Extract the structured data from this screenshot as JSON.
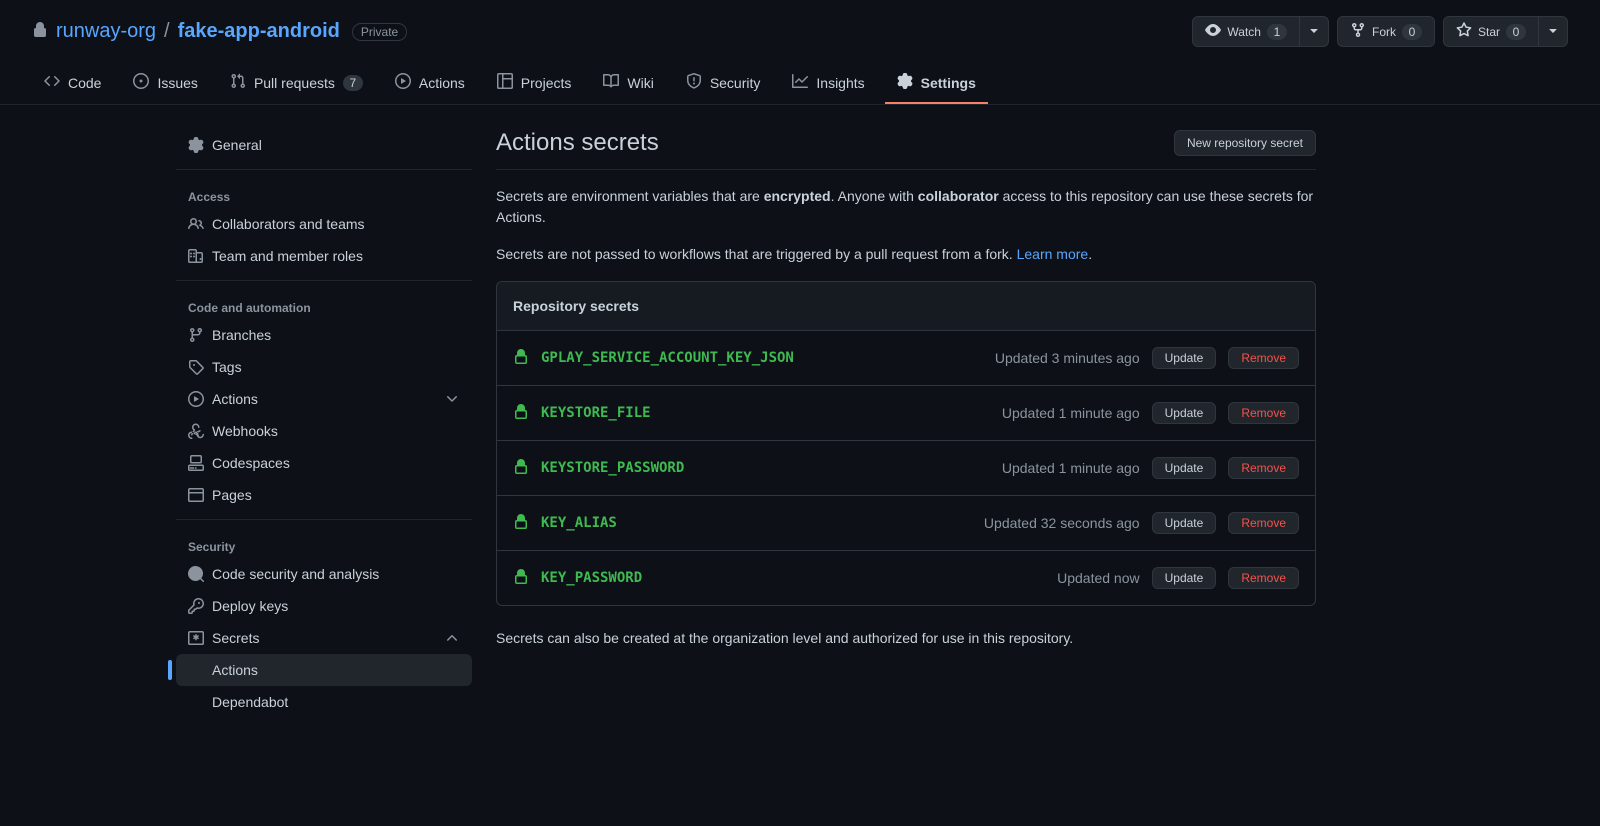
{
  "header": {
    "org": "runway-org",
    "repo": "fake-app-android",
    "visibility": "Private",
    "watch": {
      "label": "Watch",
      "count": "1"
    },
    "fork": {
      "label": "Fork",
      "count": "0"
    },
    "star": {
      "label": "Star",
      "count": "0"
    }
  },
  "tabs": {
    "code": "Code",
    "issues": "Issues",
    "pulls": "Pull requests",
    "pulls_count": "7",
    "actions": "Actions",
    "projects": "Projects",
    "wiki": "Wiki",
    "security": "Security",
    "insights": "Insights",
    "settings": "Settings"
  },
  "sidebar": {
    "general": "General",
    "access_title": "Access",
    "collaborators": "Collaborators and teams",
    "team_roles": "Team and member roles",
    "code_auto_title": "Code and automation",
    "branches": "Branches",
    "tags": "Tags",
    "actions": "Actions",
    "webhooks": "Webhooks",
    "codespaces": "Codespaces",
    "pages": "Pages",
    "security_title": "Security",
    "code_security": "Code security and analysis",
    "deploy_keys": "Deploy keys",
    "secrets": "Secrets",
    "secrets_actions": "Actions",
    "secrets_dependabot": "Dependabot"
  },
  "page": {
    "title": "Actions secrets",
    "new_secret_btn": "New repository secret",
    "desc1_a": "Secrets are environment variables that are ",
    "desc1_b": "encrypted",
    "desc1_c": ". Anyone with ",
    "desc1_d": "collaborator",
    "desc1_e": " access to this repository can use these secrets for Actions.",
    "desc2_a": "Secrets are not passed to workflows that are triggered by a pull request from a fork. ",
    "desc2_b": "Learn more",
    "desc2_c": ".",
    "panel_header": "Repository secrets",
    "update_btn": "Update",
    "remove_btn": "Remove",
    "footer": "Secrets can also be created at the organization level and authorized for use in this repository."
  },
  "secrets": [
    {
      "name": "GPLAY_SERVICE_ACCOUNT_KEY_JSON",
      "updated": "Updated 3 minutes ago"
    },
    {
      "name": "KEYSTORE_FILE",
      "updated": "Updated 1 minute ago"
    },
    {
      "name": "KEYSTORE_PASSWORD",
      "updated": "Updated 1 minute ago"
    },
    {
      "name": "KEY_ALIAS",
      "updated": "Updated 32 seconds ago"
    },
    {
      "name": "KEY_PASSWORD",
      "updated": "Updated now"
    }
  ]
}
